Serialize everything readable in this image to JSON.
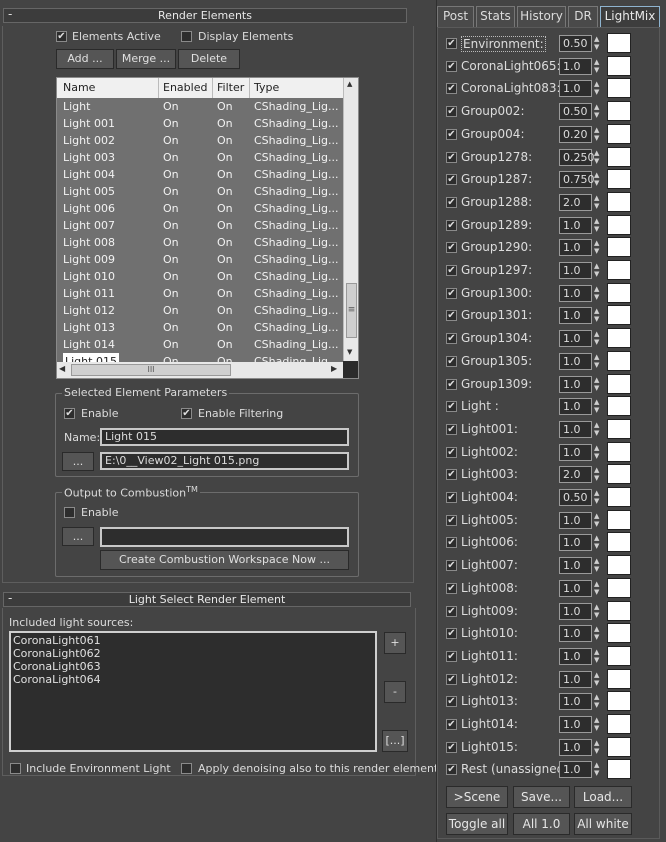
{
  "render_elements": {
    "header": "Render Elements",
    "collapse_symbol": "-",
    "elements_active_label": "Elements Active",
    "elements_active_checked": true,
    "display_elements_label": "Display Elements",
    "display_elements_checked": false,
    "buttons": {
      "add": "Add ...",
      "merge": "Merge ...",
      "delete": "Delete"
    },
    "columns": [
      "Name",
      "Enabled",
      "Filter",
      "Type"
    ],
    "rows": [
      [
        "Light",
        "On",
        "On",
        "CShading_Lig..."
      ],
      [
        "Light 001",
        "On",
        "On",
        "CShading_Lig..."
      ],
      [
        "Light 002",
        "On",
        "On",
        "CShading_Lig..."
      ],
      [
        "Light 003",
        "On",
        "On",
        "CShading_Lig..."
      ],
      [
        "Light 004",
        "On",
        "On",
        "CShading_Lig..."
      ],
      [
        "Light 005",
        "On",
        "On",
        "CShading_Lig..."
      ],
      [
        "Light 006",
        "On",
        "On",
        "CShading_Lig..."
      ],
      [
        "Light 007",
        "On",
        "On",
        "CShading_Lig..."
      ],
      [
        "Light 008",
        "On",
        "On",
        "CShading_Lig..."
      ],
      [
        "Light 009",
        "On",
        "On",
        "CShading_Lig..."
      ],
      [
        "Light 010",
        "On",
        "On",
        "CShading_Lig..."
      ],
      [
        "Light 011",
        "On",
        "On",
        "CShading_Lig..."
      ],
      [
        "Light 012",
        "On",
        "On",
        "CShading_Lig..."
      ],
      [
        "Light 013",
        "On",
        "On",
        "CShading_Lig..."
      ],
      [
        "Light 014",
        "On",
        "On",
        "CShading_Lig..."
      ],
      [
        "Light 015",
        "On",
        "On",
        "CShading_Lig..."
      ]
    ],
    "scroll_grip": "≡",
    "hscroll_grip": "III",
    "selected_params": {
      "title": "Selected Element Parameters",
      "enable_label": "Enable",
      "enable_checked": true,
      "enable_filtering_label": "Enable Filtering",
      "enable_filtering_checked": true,
      "name_label": "Name:",
      "name_value": "Light 015",
      "path_button": "...",
      "path_value": "E:\\0__View02_Light 015.png"
    },
    "combustion": {
      "title": "Output to Combustion",
      "title_sup": "TM",
      "enable_label": "Enable",
      "enable_checked": false,
      "path_button": "...",
      "path_value": "",
      "create_button": "Create Combustion Workspace Now ..."
    }
  },
  "light_select": {
    "header": "Light Select Render Element",
    "collapse_symbol": "-",
    "included_label": "Included light sources:",
    "sources": [
      "CoronaLight061",
      "CoronaLight062",
      "CoronaLight063",
      "CoronaLight064"
    ],
    "add_button": "+",
    "remove_button": "-",
    "browse_button": "[...]",
    "include_env_label": "Include Environment Light",
    "include_env_checked": false,
    "denoise_label": "Apply denoising also to this render element",
    "denoise_checked": false
  },
  "lightmix": {
    "tabs": [
      "Post",
      "Stats",
      "History",
      "DR",
      "LightMix"
    ],
    "active_tab": "LightMix",
    "rows": [
      {
        "name": "Environment:",
        "value": "0.50",
        "checked": true
      },
      {
        "name": "CoronaLight065:",
        "value": "1.0",
        "checked": true
      },
      {
        "name": "CoronaLight083:",
        "value": "1.0",
        "checked": true
      },
      {
        "name": "Group002:",
        "value": "0.50",
        "checked": true
      },
      {
        "name": "Group004:",
        "value": "0.20",
        "checked": true
      },
      {
        "name": "Group1278:",
        "value": "0.250",
        "checked": true
      },
      {
        "name": "Group1287:",
        "value": "0.750",
        "checked": true
      },
      {
        "name": "Group1288:",
        "value": "2.0",
        "checked": true
      },
      {
        "name": "Group1289:",
        "value": "1.0",
        "checked": true
      },
      {
        "name": "Group1290:",
        "value": "1.0",
        "checked": true
      },
      {
        "name": "Group1297:",
        "value": "1.0",
        "checked": true
      },
      {
        "name": "Group1300:",
        "value": "1.0",
        "checked": true
      },
      {
        "name": "Group1301:",
        "value": "1.0",
        "checked": true
      },
      {
        "name": "Group1304:",
        "value": "1.0",
        "checked": true
      },
      {
        "name": "Group1305:",
        "value": "1.0",
        "checked": true
      },
      {
        "name": "Group1309:",
        "value": "1.0",
        "checked": true
      },
      {
        "name": "Light :",
        "value": "1.0",
        "checked": true
      },
      {
        "name": "Light001:",
        "value": "1.0",
        "checked": true
      },
      {
        "name": "Light002:",
        "value": "1.0",
        "checked": true
      },
      {
        "name": "Light003:",
        "value": "2.0",
        "checked": true
      },
      {
        "name": "Light004:",
        "value": "0.50",
        "checked": true
      },
      {
        "name": "Light005:",
        "value": "1.0",
        "checked": true
      },
      {
        "name": "Light006:",
        "value": "1.0",
        "checked": true
      },
      {
        "name": "Light007:",
        "value": "1.0",
        "checked": true
      },
      {
        "name": "Light008:",
        "value": "1.0",
        "checked": true
      },
      {
        "name": "Light009:",
        "value": "1.0",
        "checked": true
      },
      {
        "name": "Light010:",
        "value": "1.0",
        "checked": true
      },
      {
        "name": "Light011:",
        "value": "1.0",
        "checked": true
      },
      {
        "name": "Light012:",
        "value": "1.0",
        "checked": true
      },
      {
        "name": "Light013:",
        "value": "1.0",
        "checked": true
      },
      {
        "name": "Light014:",
        "value": "1.0",
        "checked": true
      },
      {
        "name": "Light015:",
        "value": "1.0",
        "checked": true
      },
      {
        "name": "Rest (unassigned)",
        "value": "1.0",
        "checked": true
      }
    ],
    "spinner_arrows": "▲▼",
    "buttons_row1": [
      ">Scene",
      "Save...",
      "Load..."
    ],
    "buttons_row2": [
      "Toggle all",
      "All 1.0",
      "All white"
    ],
    "colors": {
      "swatch": "#ffffff",
      "panel_bg": "#444444",
      "active_tab_border": "#8fb4d0"
    }
  }
}
